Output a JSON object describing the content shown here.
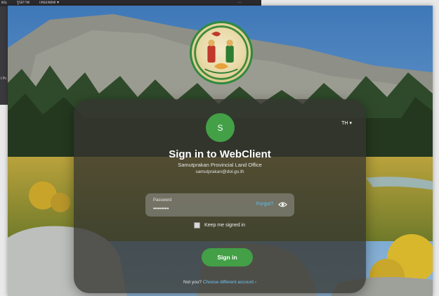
{
  "background_app": {
    "menu_items": [
      "ผน",
      "รูปภาพ",
      "เทมเพลต ▾"
    ],
    "more_label": "···",
    "side_text": "t Pc"
  },
  "emblem": {
    "icon": "provincial-seal"
  },
  "login": {
    "avatar_letter": "S",
    "language": "TH",
    "language_chevron": "▾",
    "title": "Sign in to WebClient",
    "organization": "Samutprakan Provincial Land Office",
    "email": "samutprakan@dol.go.th",
    "password_label": "Password",
    "password_value": "••••••••",
    "forgot_label": "Forgot?",
    "keep_signed_in_label": "Keep me signed in",
    "keep_signed_in_checked": false,
    "signin_label": "Sign in",
    "not_you_label": "Not you?",
    "choose_account_label": "Choose different account ›"
  },
  "colors": {
    "accent_green": "#43a047",
    "link_blue": "#5cc1f0",
    "card_bg": "rgba(52,52,48,0.78)"
  }
}
